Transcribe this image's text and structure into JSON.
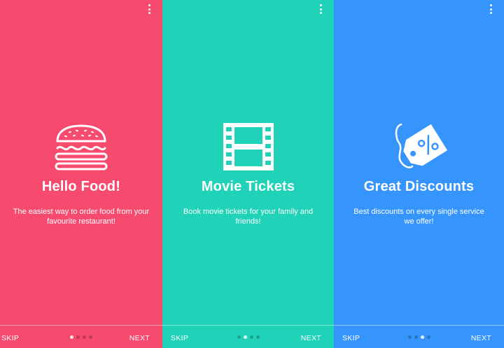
{
  "screens": [
    {
      "id": "food",
      "icon": "burger-icon",
      "title": "Hello Food!",
      "description": "The easiest way to order food from your favourite restaurant!",
      "skip": "SKIP",
      "next": "NEXT",
      "dots_total": 4,
      "active_dot": 0,
      "color": "#f74a6f"
    },
    {
      "id": "movie",
      "icon": "film-strip-icon",
      "title": "Movie Tickets",
      "description": "Book movie tickets for your family and friends!",
      "skip": "SKIP",
      "next": "NEXT",
      "dots_total": 4,
      "active_dot": 1,
      "color": "#20d3b8"
    },
    {
      "id": "discounts",
      "icon": "discount-tag-icon",
      "title": "Great Discounts",
      "description": "Best discounts on every single service we offer!",
      "skip": "SKIP",
      "next": "NEXT",
      "dots_total": 4,
      "active_dot": 2,
      "color": "#3595fd"
    }
  ]
}
